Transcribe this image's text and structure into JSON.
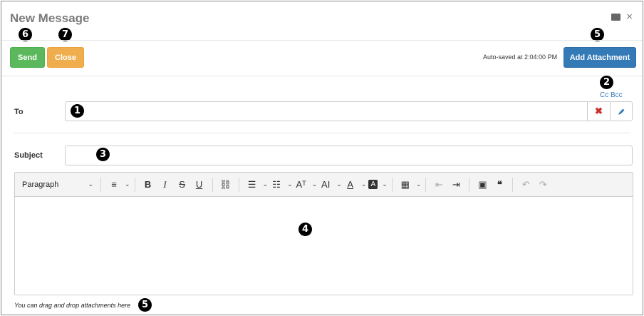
{
  "window": {
    "title": "New Message"
  },
  "toolbar": {
    "send_label": "Send",
    "close_label": "Close",
    "autosave_text": "Auto-saved at 2:04:00 PM",
    "attach_label": "Add Attachment"
  },
  "recipients": {
    "ccbcc_label": "Cc Bcc",
    "to_label": "To",
    "to_value": "",
    "clear_icon": "✖"
  },
  "subject": {
    "label": "Subject",
    "value": ""
  },
  "editor": {
    "block_format": "Paragraph",
    "tools": {
      "align": "≡",
      "bold": "B",
      "italic": "I",
      "strike": "S",
      "underline": "U",
      "link": "⛓",
      "bullet_list": "☰",
      "number_list": "☷",
      "font_size": "Aᵀ",
      "text_size": "AI",
      "font_color": "A",
      "highlight": "A",
      "table": "▦",
      "outdent": "⇤",
      "indent": "⇥",
      "image": "▣",
      "quote": "❝",
      "undo": "↶",
      "redo": "↷"
    },
    "body": ""
  },
  "footer": {
    "drag_note": "You can drag and drop attachments here"
  },
  "markers": {
    "to_field": "1",
    "ccbcc": "2",
    "subject": "3",
    "editor": "4",
    "attach": "5",
    "drag_drop": "5",
    "send": "6",
    "close": "7"
  },
  "colors": {
    "send": "#5cb85c",
    "close": "#f0ad4e",
    "attach": "#337ab7",
    "link": "#337ab7",
    "clear": "#c9302c"
  }
}
